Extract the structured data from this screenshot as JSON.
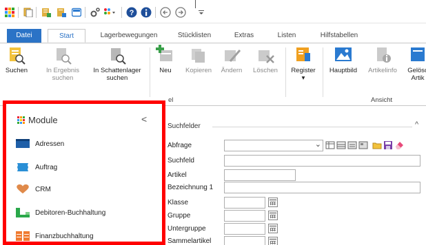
{
  "quick_access": {
    "icons": [
      "app-grid-icon",
      "copy-icon",
      "db-add-icon",
      "db-edit-icon",
      "window-icon",
      "settings-icon",
      "apps-dropdown-icon",
      "help-icon",
      "info-icon",
      "back-icon",
      "forward-icon",
      "customize-dropdown-icon"
    ]
  },
  "tabs": [
    {
      "label": "Datei",
      "state": "file"
    },
    {
      "label": "Start",
      "state": "active"
    },
    {
      "label": "Lagerbewegungen",
      "state": "normal"
    },
    {
      "label": "Stücklisten",
      "state": "normal"
    },
    {
      "label": "Extras",
      "state": "normal"
    },
    {
      "label": "Listen",
      "state": "normal"
    },
    {
      "label": "Hilfstabellen",
      "state": "normal"
    }
  ],
  "ribbon": {
    "suchen": "Suchen",
    "in_ergebnis_1": "In Ergebnis",
    "in_ergebnis_2": "suchen",
    "in_schattenlager_1": "In Schattenlager",
    "in_schattenlager_2": "suchen",
    "neu": "Neu",
    "kopieren": "Kopieren",
    "aendern": "Ändern",
    "loeschen": "Löschen",
    "register": "Register",
    "register_arrow": "▾",
    "hauptbild": "Hauptbild",
    "artikelinfo": "Artikelinfo",
    "geloeschte_1": "Gelösc",
    "geloeschte_2": "Artik",
    "group_artikel_partial": "el",
    "group_ansicht": "Ansicht"
  },
  "modules": {
    "title": "Module",
    "collapse": "<",
    "items": [
      {
        "label": "Adressen",
        "icon": "addresses-icon",
        "color": "#1f5fa8"
      },
      {
        "label": "Auftrag",
        "icon": "order-icon",
        "color": "#2a8fd6"
      },
      {
        "label": "CRM",
        "icon": "heart-icon",
        "color": "#e08a4a"
      },
      {
        "label": "Debitoren-Buchhaltung",
        "icon": "debitor-icon",
        "color": "#2aa84a"
      },
      {
        "label": "Finanzbuchhaltung",
        "icon": "finance-icon",
        "color": "#f07a30"
      }
    ]
  },
  "search": {
    "title": "Suchfelder",
    "caret": "^",
    "fields": [
      {
        "label": "Abfrage"
      },
      {
        "label": "Suchfeld"
      },
      {
        "label": "Artikel"
      },
      {
        "label": "Bezeichnung 1"
      },
      {
        "label": "Klasse"
      },
      {
        "label": "Gruppe"
      },
      {
        "label": "Untergruppe"
      },
      {
        "label": "Sammelartikel"
      }
    ],
    "dropdown_arrow": "⌄"
  }
}
